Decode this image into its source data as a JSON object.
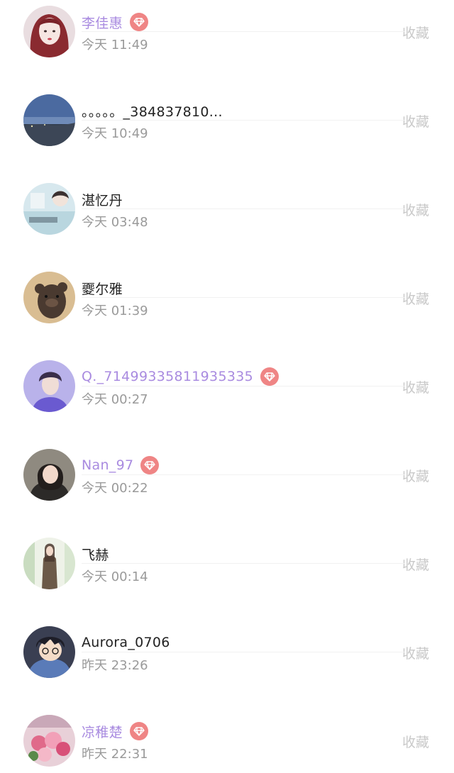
{
  "collect_label": "收藏",
  "colors": {
    "vip_name": "#a98be0",
    "vip_badge": "#ef8585",
    "name": "#222222",
    "time": "#9a9a9a",
    "collect": "#c9c9c9"
  },
  "rows": [
    {
      "name": "李佳惠",
      "time": "今天 11:49",
      "vip": true,
      "avatar": "girl-red-hair-avatar"
    },
    {
      "name": "。。。。。_384837810...",
      "time": "今天 10:49",
      "vip": false,
      "avatar": "night-landscape-avatar"
    },
    {
      "name": "湛忆丹",
      "time": "今天 03:48",
      "vip": false,
      "avatar": "illustration-avatar"
    },
    {
      "name": "夒尔雅",
      "time": "今天 01:39",
      "vip": false,
      "avatar": "bear-avatar"
    },
    {
      "name": "Q._71499335811935335",
      "time": "今天 00:27",
      "vip": true,
      "avatar": "purple-portrait-avatar"
    },
    {
      "name": "Nan_97",
      "time": "今天 00:22",
      "vip": true,
      "avatar": "woman-portrait-avatar"
    },
    {
      "name": "飞赫",
      "time": "今天 00:14",
      "vip": false,
      "avatar": "standing-woman-avatar"
    },
    {
      "name": "Aurora_0706",
      "time": "昨天 23:26",
      "vip": false,
      "avatar": "anime-boy-avatar"
    },
    {
      "name": "凉稚楚",
      "time": "昨天 22:31",
      "vip": true,
      "avatar": "flowers-avatar"
    }
  ]
}
